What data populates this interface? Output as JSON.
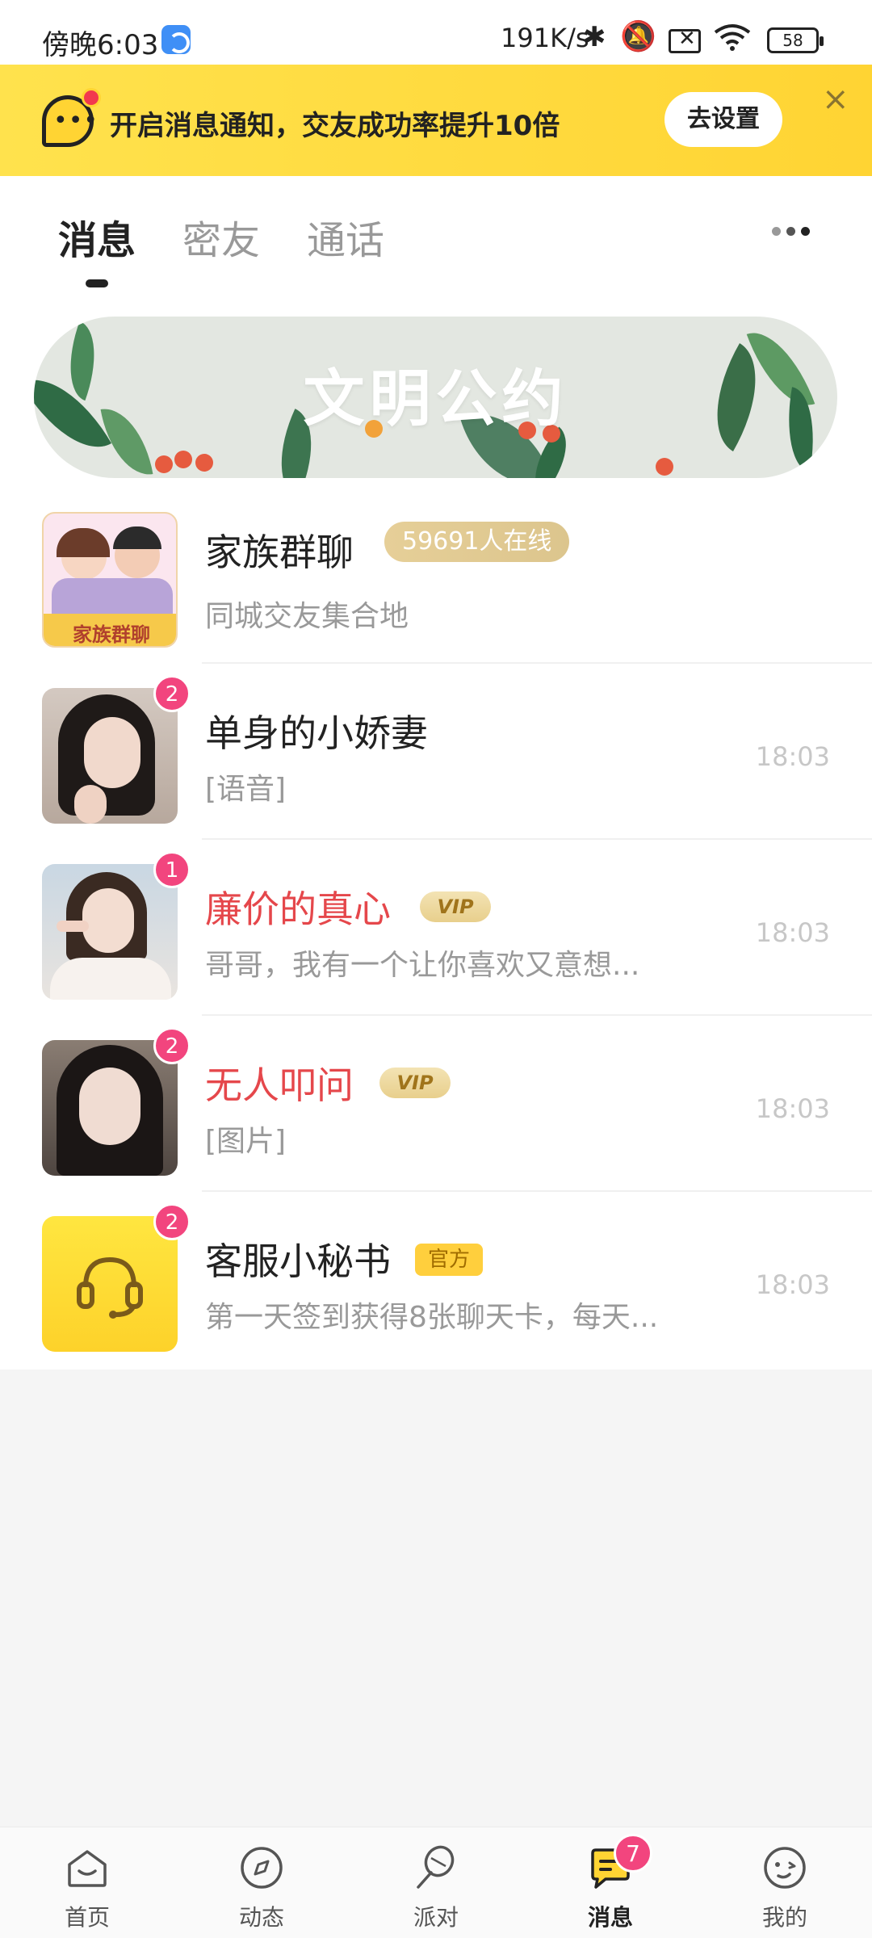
{
  "status_bar": {
    "time": "傍晚6:03",
    "net_speed": "191K/s",
    "battery": "58"
  },
  "notification": {
    "text": "开启消息通知，交友成功率提升10倍",
    "button": "去设置",
    "close": "×"
  },
  "tabs": [
    {
      "label": "消息",
      "active": true
    },
    {
      "label": "密友",
      "active": false
    },
    {
      "label": "通话",
      "active": false
    }
  ],
  "banner": {
    "title": "文明公约"
  },
  "conversations": [
    {
      "name": "家族群聊",
      "preview": "同城交友集合地",
      "online": "59691人在线",
      "time": "",
      "badge": ""
    },
    {
      "name": "单身的小娇妻",
      "preview": "[语音]",
      "time": "18:03",
      "badge": "2"
    },
    {
      "name": "廉价的真心",
      "preview": "哥哥，我有一个让你喜欢又意想...",
      "time": "18:03",
      "badge": "1",
      "tag": "VIP"
    },
    {
      "name": "无人叩问",
      "preview": "[图片]",
      "time": "18:03",
      "badge": "2",
      "tag": "VIP"
    },
    {
      "name": "客服小秘书",
      "preview": "第一天签到获得8张聊天卡，每天...",
      "time": "18:03",
      "badge": "2",
      "tag": "官方"
    }
  ],
  "group_avatar_text": "家族群聊",
  "bottom_nav": [
    {
      "label": "首页",
      "icon": "home-icon"
    },
    {
      "label": "动态",
      "icon": "compass-icon"
    },
    {
      "label": "派对",
      "icon": "balloon-icon"
    },
    {
      "label": "消息",
      "icon": "message-icon",
      "active": true,
      "badge": "7"
    },
    {
      "label": "我的",
      "icon": "profile-face-icon"
    }
  ],
  "colors": {
    "accent_yellow": "#ffd433",
    "badge_pink": "#f2457e",
    "vip_red": "#e5474b"
  }
}
